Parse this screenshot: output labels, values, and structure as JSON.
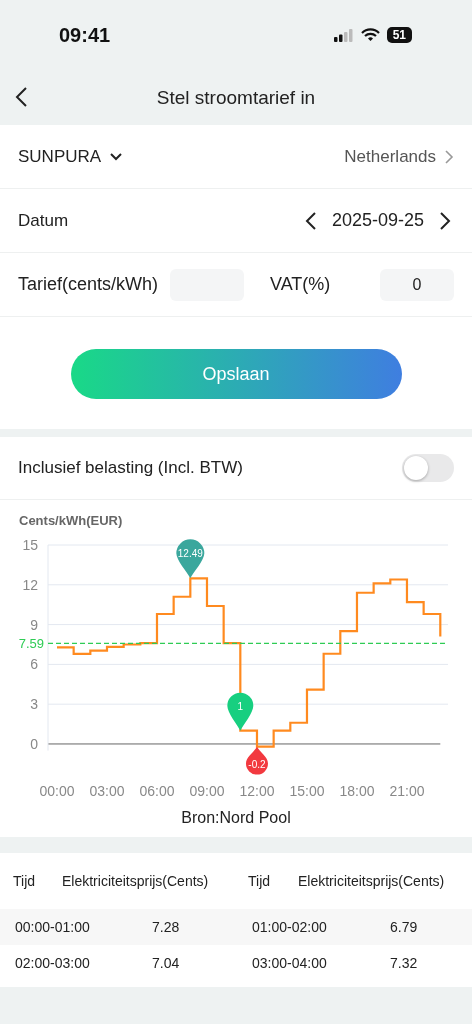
{
  "status_bar": {
    "time": "09:41",
    "battery": "51"
  },
  "header": {
    "title": "Stel stroomtarief in"
  },
  "settings": {
    "provider": "SUNPURA",
    "country": "Netherlands",
    "date_label": "Datum",
    "date": "2025-09-25",
    "tariff_label": "Tarief(cents/kWh)",
    "vat_label": "VAT(%)",
    "vat_value": "0",
    "save": "Opslaan"
  },
  "tax_toggle": {
    "label": "Inclusief belasting (Incl. BTW)",
    "on": false
  },
  "chart_data": {
    "type": "line",
    "ylabel": "Cents/kWh(EUR)",
    "grid": true,
    "x": [
      0,
      1,
      1,
      2,
      2,
      3,
      3,
      4,
      4,
      5,
      5,
      6,
      6,
      7,
      7,
      8,
      8,
      9,
      9,
      10,
      10,
      11,
      11,
      12,
      12,
      13,
      13,
      14,
      14,
      15,
      15,
      16,
      16,
      17,
      17,
      18,
      18,
      19,
      19,
      20,
      20,
      21,
      21,
      22,
      22,
      23,
      23
    ],
    "series": [
      {
        "color": "#ff8a1f",
        "values": [
          7.28,
          7.28,
          6.79,
          6.79,
          7.04,
          7.04,
          7.32,
          7.32,
          7.5,
          7.5,
          7.6,
          7.6,
          9.8,
          9.8,
          11.1,
          11.1,
          12.49,
          12.49,
          10.4,
          10.4,
          7.6,
          7.6,
          1,
          1,
          -0.2,
          -0.2,
          1,
          1,
          1.6,
          1.6,
          4.1,
          4.1,
          6.8,
          6.8,
          8.5,
          8.5,
          11.4,
          11.4,
          12.1,
          12.1,
          12.4,
          12.4,
          10.7,
          10.7,
          9.8,
          9.8,
          8.1
        ]
      }
    ],
    "xlim": [
      0,
      23
    ],
    "ylim": [
      -0.5,
      15
    ],
    "yticks": [
      0,
      3,
      6,
      9,
      12,
      15
    ],
    "xticks": [
      {
        "value": 0,
        "label": "00:00"
      },
      {
        "value": 3,
        "label": "03:00"
      },
      {
        "value": 6,
        "label": "06:00"
      },
      {
        "value": 9,
        "label": "09:00"
      },
      {
        "value": 12,
        "label": "12:00"
      },
      {
        "value": 15,
        "label": "15:00"
      },
      {
        "value": 18,
        "label": "18:00"
      },
      {
        "value": 21,
        "label": "21:00"
      }
    ],
    "ref_lines": [
      {
        "axis": "y",
        "value": 7.59,
        "label": "7.59",
        "color": "#2fcc55"
      }
    ],
    "annotations": [
      {
        "x": 8,
        "y": 12.49,
        "text": "12.49"
      },
      {
        "x": 11,
        "y": 1,
        "text": "1"
      },
      {
        "x": 12,
        "y": -0.2,
        "text": "-0.2"
      }
    ]
  },
  "source": "Bron:Nord Pool",
  "table": {
    "columns": [
      "Tijd",
      "Elektriciteitsprijs(Cents)",
      "Tijd",
      "Elektriciteitsprijs(Cents)"
    ],
    "rows": [
      [
        "00:00-01:00",
        "7.28",
        "01:00-02:00",
        "6.79"
      ],
      [
        "02:00-03:00",
        "7.04",
        "03:00-04:00",
        "7.32"
      ]
    ]
  }
}
